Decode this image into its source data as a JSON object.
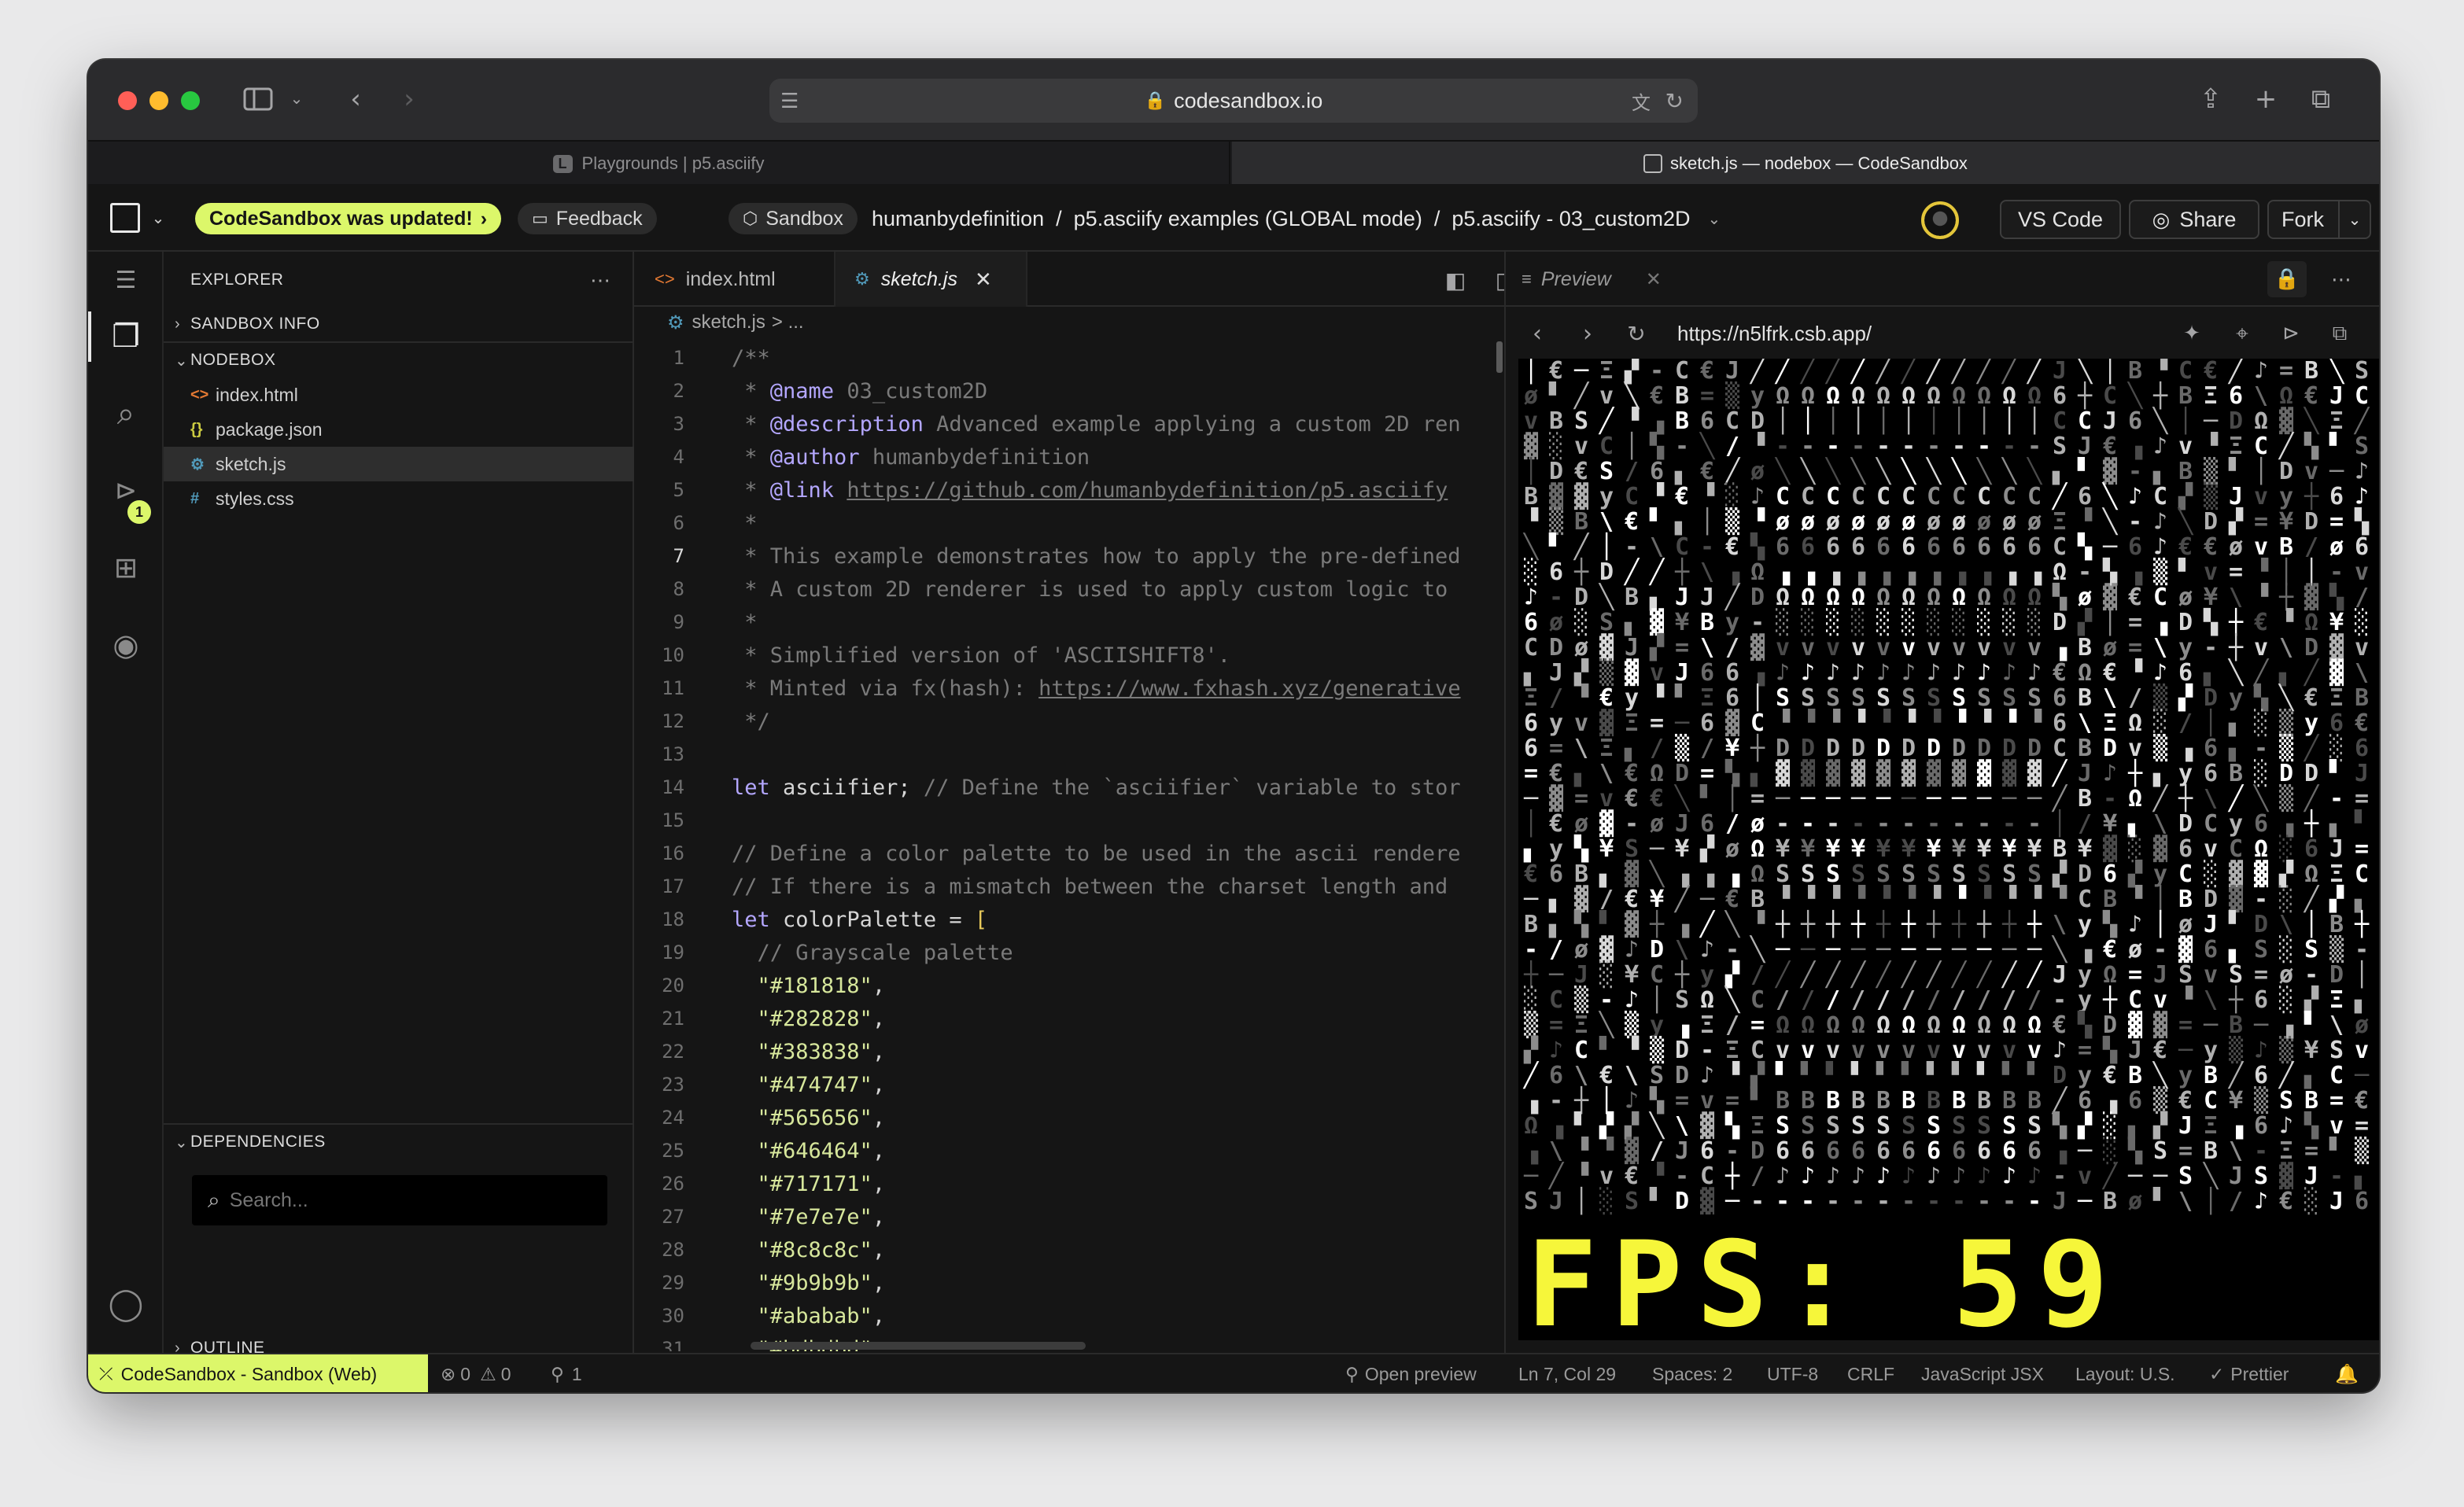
{
  "browser": {
    "url": "codesandbox.io",
    "tabs": [
      {
        "label": "Playgrounds | p5.asciify",
        "badge": "L",
        "active": false
      },
      {
        "label": "sketch.js — nodebox — CodeSandbox",
        "active": true
      }
    ]
  },
  "topbar": {
    "update_pill": "CodeSandbox was updated!",
    "feedback_label": "Feedback",
    "sandbox_label": "Sandbox",
    "path": "humanbydefinition  /  p5.asciify examples (GLOBAL mode)  /  p5.asciify - 03_custom2D",
    "vscode_label": "VS Code",
    "share_label": "Share",
    "fork_label": "Fork"
  },
  "sidebar": {
    "explorer_title": "EXPLORER",
    "section_info": "SANDBOX INFO",
    "section_nodebox": "NODEBOX",
    "files": [
      {
        "name": "index.html",
        "icon": "<>",
        "color": "#e37933"
      },
      {
        "name": "package.json",
        "icon": "{}",
        "color": "#cbcb41"
      },
      {
        "name": "sketch.js",
        "icon": "⚙",
        "color": "#519aba",
        "selected": true
      },
      {
        "name": "styles.css",
        "icon": "#",
        "color": "#519aba"
      }
    ],
    "dependencies_title": "DEPENDENCIES",
    "search_placeholder": "Search...",
    "outline_title": "OUTLINE",
    "badge_count": "1"
  },
  "editor": {
    "tabs": [
      {
        "label": "index.html",
        "active": false
      },
      {
        "label": "sketch.js",
        "active": true
      }
    ],
    "breadcrumb_file": "sketch.js",
    "breadcrumb_rest": "> ...",
    "active_line": 7,
    "lines": [
      {
        "n": "1",
        "segs": [
          {
            "t": "/**",
            "c": "#7a7a7a"
          }
        ]
      },
      {
        "n": "2",
        "segs": [
          {
            "t": " * ",
            "c": "#7a7a7a"
          },
          {
            "t": "@name",
            "c": "#b4a7ff"
          },
          {
            "t": " 03_custom2D",
            "c": "#7a7a7a"
          }
        ]
      },
      {
        "n": "3",
        "segs": [
          {
            "t": " * ",
            "c": "#7a7a7a"
          },
          {
            "t": "@description",
            "c": "#b4a7ff"
          },
          {
            "t": " Advanced example applying a custom 2D ren",
            "c": "#7a7a7a"
          }
        ]
      },
      {
        "n": "4",
        "segs": [
          {
            "t": " * ",
            "c": "#7a7a7a"
          },
          {
            "t": "@author",
            "c": "#b4a7ff"
          },
          {
            "t": " humanbydefinition",
            "c": "#7a7a7a"
          }
        ]
      },
      {
        "n": "5",
        "segs": [
          {
            "t": " * ",
            "c": "#7a7a7a"
          },
          {
            "t": "@link",
            "c": "#b4a7ff"
          },
          {
            "t": " ",
            "c": "#7a7a7a"
          },
          {
            "t": "https://github.com/humanbydefinition/p5.asciify",
            "c": "#7a7a7a",
            "u": true
          }
        ]
      },
      {
        "n": "6",
        "segs": [
          {
            "t": " *",
            "c": "#7a7a7a"
          }
        ]
      },
      {
        "n": "7",
        "segs": [
          {
            "t": " * This example demonstrates how to apply the pre-defined",
            "c": "#7a7a7a"
          }
        ]
      },
      {
        "n": "8",
        "segs": [
          {
            "t": " * A custom 2D renderer is used to apply custom logic to",
            "c": "#7a7a7a"
          }
        ]
      },
      {
        "n": "9",
        "segs": [
          {
            "t": " *",
            "c": "#7a7a7a"
          }
        ]
      },
      {
        "n": "10",
        "segs": [
          {
            "t": " * Simplified version of 'ASCIISHIFT8'.",
            "c": "#7a7a7a"
          }
        ]
      },
      {
        "n": "11",
        "segs": [
          {
            "t": " * Minted via fx(hash): ",
            "c": "#7a7a7a"
          },
          {
            "t": "https://www.fxhash.xyz/generative",
            "c": "#7a7a7a",
            "u": true
          }
        ]
      },
      {
        "n": "12",
        "segs": [
          {
            "t": " */",
            "c": "#7a7a7a"
          }
        ]
      },
      {
        "n": "13",
        "segs": []
      },
      {
        "n": "14",
        "segs": [
          {
            "t": "let",
            "c": "#b4a7ff"
          },
          {
            "t": " asciifier; ",
            "c": "#d6d6d6"
          },
          {
            "t": "// Define the `asciifier` variable to stor",
            "c": "#7a7a7a"
          }
        ]
      },
      {
        "n": "15",
        "segs": []
      },
      {
        "n": "16",
        "segs": [
          {
            "t": "// Define a color palette to be used in the ascii rendere",
            "c": "#7a7a7a"
          }
        ]
      },
      {
        "n": "17",
        "segs": [
          {
            "t": "// If there is a mismatch between the charset length and",
            "c": "#7a7a7a"
          }
        ]
      },
      {
        "n": "18",
        "segs": [
          {
            "t": "let",
            "c": "#b4a7ff"
          },
          {
            "t": " colorPalette = ",
            "c": "#d6d6d6"
          },
          {
            "t": "[",
            "c": "#e8c95a"
          }
        ]
      },
      {
        "n": "19",
        "segs": [
          {
            "t": "  // Grayscale palette",
            "c": "#7a7a7a"
          }
        ]
      },
      {
        "n": "20",
        "segs": [
          {
            "t": "  \"#181818\"",
            "c": "#d7e79c"
          },
          {
            "t": ",",
            "c": "#d6d6d6"
          }
        ]
      },
      {
        "n": "21",
        "segs": [
          {
            "t": "  \"#282828\"",
            "c": "#d7e79c"
          },
          {
            "t": ",",
            "c": "#d6d6d6"
          }
        ]
      },
      {
        "n": "22",
        "segs": [
          {
            "t": "  \"#383838\"",
            "c": "#d7e79c"
          },
          {
            "t": ",",
            "c": "#d6d6d6"
          }
        ]
      },
      {
        "n": "23",
        "segs": [
          {
            "t": "  \"#474747\"",
            "c": "#d7e79c"
          },
          {
            "t": ",",
            "c": "#d6d6d6"
          }
        ]
      },
      {
        "n": "24",
        "segs": [
          {
            "t": "  \"#565656\"",
            "c": "#d7e79c"
          },
          {
            "t": ",",
            "c": "#d6d6d6"
          }
        ]
      },
      {
        "n": "25",
        "segs": [
          {
            "t": "  \"#646464\"",
            "c": "#d7e79c"
          },
          {
            "t": ",",
            "c": "#d6d6d6"
          }
        ]
      },
      {
        "n": "26",
        "segs": [
          {
            "t": "  \"#717171\"",
            "c": "#d7e79c"
          },
          {
            "t": ",",
            "c": "#d6d6d6"
          }
        ]
      },
      {
        "n": "27",
        "segs": [
          {
            "t": "  \"#7e7e7e\"",
            "c": "#d7e79c"
          },
          {
            "t": ",",
            "c": "#d6d6d6"
          }
        ]
      },
      {
        "n": "28",
        "segs": [
          {
            "t": "  \"#8c8c8c\"",
            "c": "#d7e79c"
          },
          {
            "t": ",",
            "c": "#d6d6d6"
          }
        ]
      },
      {
        "n": "29",
        "segs": [
          {
            "t": "  \"#9b9b9b\"",
            "c": "#d7e79c"
          },
          {
            "t": ",",
            "c": "#d6d6d6"
          }
        ]
      },
      {
        "n": "30",
        "segs": [
          {
            "t": "  \"#ababab\"",
            "c": "#d7e79c"
          },
          {
            "t": ",",
            "c": "#d6d6d6"
          }
        ]
      },
      {
        "n": "31",
        "segs": [
          {
            "t": "  \"#bdbdbd\"",
            "c": "#d7e79c"
          }
        ]
      }
    ]
  },
  "preview": {
    "tab_label": "Preview",
    "url": "https://n5lfrk.csb.app/",
    "fps_text": "FPS: 59"
  },
  "status": {
    "remote": "CodeSandbox - Sandbox (Web)",
    "errors": "0",
    "warnings": "0",
    "ports": "1",
    "open_preview": "Open preview",
    "position": "Ln 7, Col 29",
    "spaces": "Spaces: 2",
    "encoding": "UTF-8",
    "eol": "CRLF",
    "language": "JavaScript JSX",
    "layout": "Layout: U.S.",
    "formatter": "Prettier"
  },
  "colors": {
    "accent_green": "#dcf76a",
    "fps_yellow": "#f6f63a"
  }
}
